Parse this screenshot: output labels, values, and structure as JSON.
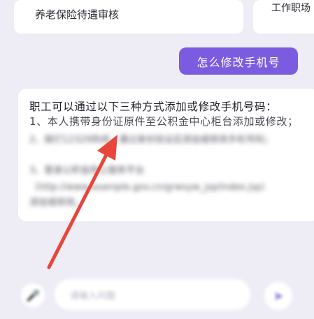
{
  "suggestions": [
    {
      "label": "养老保险待遇审核"
    },
    {
      "label": "工作职场"
    }
  ],
  "user_message": "怎么修改手机号",
  "answer": {
    "title": "职工可以通过以下三种方式添加或修改手机号码：",
    "item1": "1、本人携带身份证原件至公积金中心柜台添加或修改；",
    "item2_blurred": "2、拨打12329热线，通过身份验证后添加或修改手机号码；",
    "item3_blurred": "3、登录公积金网上服务平台",
    "item3_url_blurred": "（http://www.example.gov.cn/grwsyw_jsp/index.jsp）",
    "item3_tail_blurred": "添加或修改。"
  },
  "input": {
    "placeholder": "请输入问题"
  },
  "icons": {
    "mic": "microphone-icon",
    "send": "send-icon"
  },
  "colors": {
    "accent": "#7b5ce0",
    "background": "#eeedf6",
    "arrow": "#e8453c"
  }
}
